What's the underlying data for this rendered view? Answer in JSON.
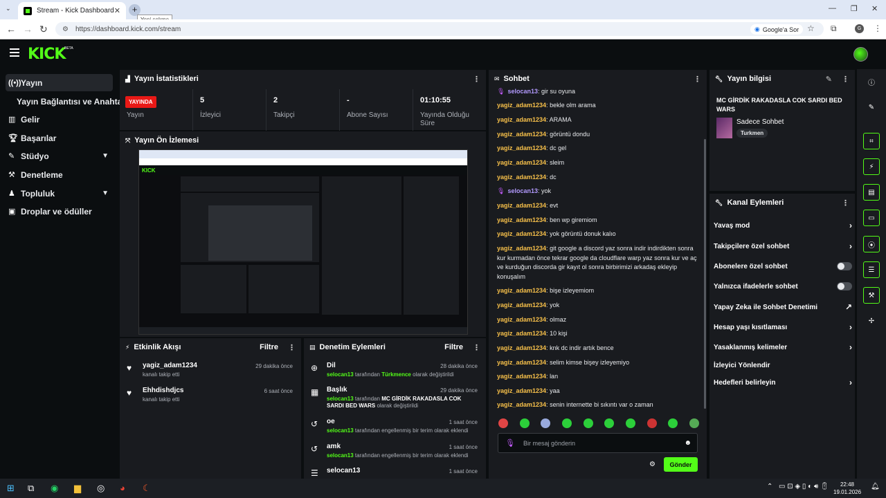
{
  "browser": {
    "tab_title": "Stream - Kick Dashboard",
    "tab_close": "✕",
    "new_tab": "+",
    "tooltip": "Yeni sekme",
    "url": "https://dashboard.kick.com/stream",
    "google_sor": "Google'a Sor",
    "profile_initial": "G"
  },
  "app": {
    "logo": "KICK",
    "beta": "BETA"
  },
  "sidebar": {
    "items": [
      {
        "label": "Yayın",
        "icon": "broadcast-icon"
      },
      {
        "label": "Yayın Bağlantısı ve Anahtarı"
      },
      {
        "label": "Gelir",
        "icon": "chart-icon"
      },
      {
        "label": "Başarılar",
        "icon": "trophy-icon"
      },
      {
        "label": "Stüdyo",
        "icon": "studio-icon"
      },
      {
        "label": "Denetleme",
        "icon": "hammer-icon"
      },
      {
        "label": "Topluluk",
        "icon": "community-icon"
      },
      {
        "label": "Droplar ve ödüller",
        "icon": "gift-icon"
      }
    ]
  },
  "stats": {
    "title": "Yayın İstatistikleri",
    "live_badge": "YAYINDA",
    "items": [
      {
        "value": "",
        "label": "Yayın"
      },
      {
        "value": "5",
        "label": "İzleyici"
      },
      {
        "value": "2",
        "label": "Takipçi"
      },
      {
        "value": "-",
        "label": "Abone Sayısı"
      },
      {
        "value": "01:10:55",
        "label": "Yayında Olduğu Süre"
      }
    ]
  },
  "preview": {
    "title": "Yayın Ön İzlemesi"
  },
  "activity": {
    "title": "Etkinlik Akışı",
    "filter": "Filtre",
    "items": [
      {
        "who": "yagiz_adam1234",
        "what": "kanalı takip etti",
        "when": "29 dakika önce"
      },
      {
        "who": "Ehhdishdjcs",
        "what": "kanalı takip etti",
        "when": "6 saat önce"
      }
    ]
  },
  "moderation": {
    "title": "Denetim Eylemleri",
    "filter": "Filtre",
    "items": [
      {
        "title": "Dil",
        "user": "selocan13",
        "by": " tarafından ",
        "value": "Türkmence",
        "rest": " olarak değiştirildi",
        "when": "28 dakika önce"
      },
      {
        "title": "Başlık",
        "user": "selocan13",
        "by": " tarafından ",
        "value": "MC GİRDİK RAKADASLA COK SARDI BED WARS",
        "rest": " olarak değiştirildi",
        "when": "29 dakika önce"
      },
      {
        "title": "oe",
        "user": "selocan13",
        "by": " tarafından engellenmiş bir terim olarak eklendi",
        "value": "",
        "rest": "",
        "when": "1 saat önce"
      },
      {
        "title": "amk",
        "user": "selocan13",
        "by": " tarafından engellenmiş bir terim olarak eklendi",
        "value": "",
        "rest": "",
        "when": "1 saat önce"
      },
      {
        "title": "selocan13",
        "user": "",
        "by": "",
        "value": "",
        "rest": "",
        "when": "1 saat önce"
      }
    ]
  },
  "chat": {
    "title": "Sohbet",
    "messages": [
      {
        "user": "selocan13",
        "text": "gir su oyuna",
        "mod": true
      },
      {
        "user": "yagiz_adam1234",
        "text": "bekle olm arama"
      },
      {
        "user": "yagiz_adam1234",
        "text": "ARAMA"
      },
      {
        "user": "yagiz_adam1234",
        "text": "görüntü dondu"
      },
      {
        "user": "yagiz_adam1234",
        "text": "dc gel"
      },
      {
        "user": "yagiz_adam1234",
        "text": "sleim"
      },
      {
        "user": "yagiz_adam1234",
        "text": "dc"
      },
      {
        "user": "selocan13",
        "text": "yok",
        "mod": true
      },
      {
        "user": "yagiz_adam1234",
        "text": "evt"
      },
      {
        "user": "yagiz_adam1234",
        "text": "ben wp giremiom"
      },
      {
        "user": "yagiz_adam1234",
        "text": "yok görüntü donuk kalıo"
      },
      {
        "user": "yagiz_adam1234",
        "text": "git google a discord yaz sonra indir indirdikten sonra kur kurmadan önce tekrar google da cloudflare warp yaz sonra kur ve aç ve kurduğun discorda gir kayıt ol sonra birbirimizi arkadaş ekleyip konuşalım"
      },
      {
        "user": "yagiz_adam1234",
        "text": "bişe izleyemiom"
      },
      {
        "user": "yagiz_adam1234",
        "text": "yok"
      },
      {
        "user": "yagiz_adam1234",
        "text": "olmaz"
      },
      {
        "user": "yagiz_adam1234",
        "text": "10 kişi"
      },
      {
        "user": "yagiz_adam1234",
        "text": "knk dc indir artık bence"
      },
      {
        "user": "yagiz_adam1234",
        "text": "selim kimse bişey izleyemiyo"
      },
      {
        "user": "yagiz_adam1234",
        "text": "lan"
      },
      {
        "user": "yagiz_adam1234",
        "text": "yaa"
      },
      {
        "user": "yagiz_adam1234",
        "text": "senin internette bi sıkıntı var o zaman"
      }
    ],
    "input_placeholder": "Bir mesaj gönderin",
    "send": "Gönder"
  },
  "stream_info": {
    "title": "Yayın bilgisi",
    "stream_title": "MC GİRDİK RAKADASLA COK SARDI BED WARS",
    "category": "Sadece Sohbet",
    "tag": "Turkmen"
  },
  "channel_actions": {
    "title": "Kanal Eylemleri",
    "items": [
      {
        "label": "Yavaş mod",
        "ctrl": "arrow"
      },
      {
        "label": "Takipçilere özel sohbet",
        "ctrl": "arrow"
      },
      {
        "label": "Abonelere özel sohbet",
        "ctrl": "toggle"
      },
      {
        "label": "Yalnızca ifadelerle sohbet",
        "ctrl": "toggle"
      },
      {
        "label": "Yapay Zeka ile Sohbet Denetimi",
        "ctrl": "external"
      },
      {
        "label": "Hesap yaşı kısıtlaması",
        "ctrl": "arrow"
      },
      {
        "label": "Yasaklanmış kelimeler",
        "ctrl": "arrow"
      },
      {
        "label": "İzleyici Yönlendir",
        "ctrl": "none"
      },
      {
        "label": "Hedefleri belirleyin",
        "ctrl": "arrow"
      }
    ]
  },
  "taskbar": {
    "time": "22:48",
    "date": "19.01.2026"
  }
}
